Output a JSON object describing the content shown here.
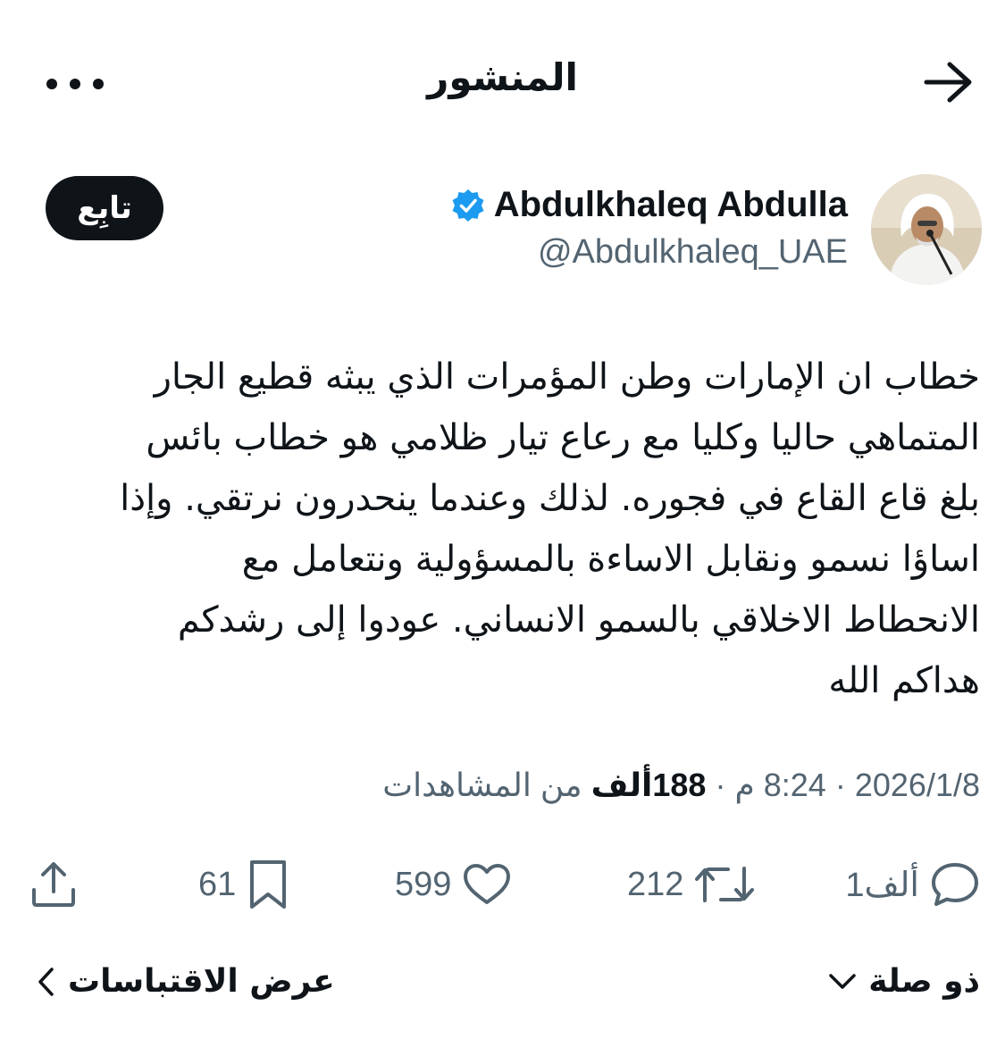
{
  "header": {
    "title": "المنشور"
  },
  "author": {
    "name": "Abdulkhaleq Abdulla",
    "handle": "@Abdulkhaleq_UAE",
    "verified": true,
    "follow_label": "تابِع"
  },
  "tweet": {
    "lines": [
      "خطاب ان الإمارات وطن المؤمرات الذي يبثه قطيع الجار",
      "المتماهي حاليا وكليا مع رعاع تيار ظلامي هو خطاب بائس",
      "بلغ قاع القاع في فجوره. لذلك وعندما ينحدرون نرتقي. وإذا",
      "اساؤا نسمو ونقابل الاساءة بالمسؤولية ونتعامل مع",
      "الانحطاط الاخلاقي بالسمو الانساني. عودوا إلى رشدكم",
      "هداكم الله"
    ]
  },
  "meta": {
    "date": "2026/1/8",
    "separator": "·",
    "time": "8:24 م",
    "views_count": "188ألف",
    "views_label": "من المشاهدات"
  },
  "actions": {
    "replies": "1ألف",
    "reposts": "212",
    "likes": "599",
    "bookmarks": "61"
  },
  "footer": {
    "related_label": "ذو صلة",
    "quotes_label": "عرض الاقتباسات"
  },
  "colors": {
    "text": "#0f1419",
    "secondary": "#536471",
    "verified": "#1d9bf0"
  }
}
